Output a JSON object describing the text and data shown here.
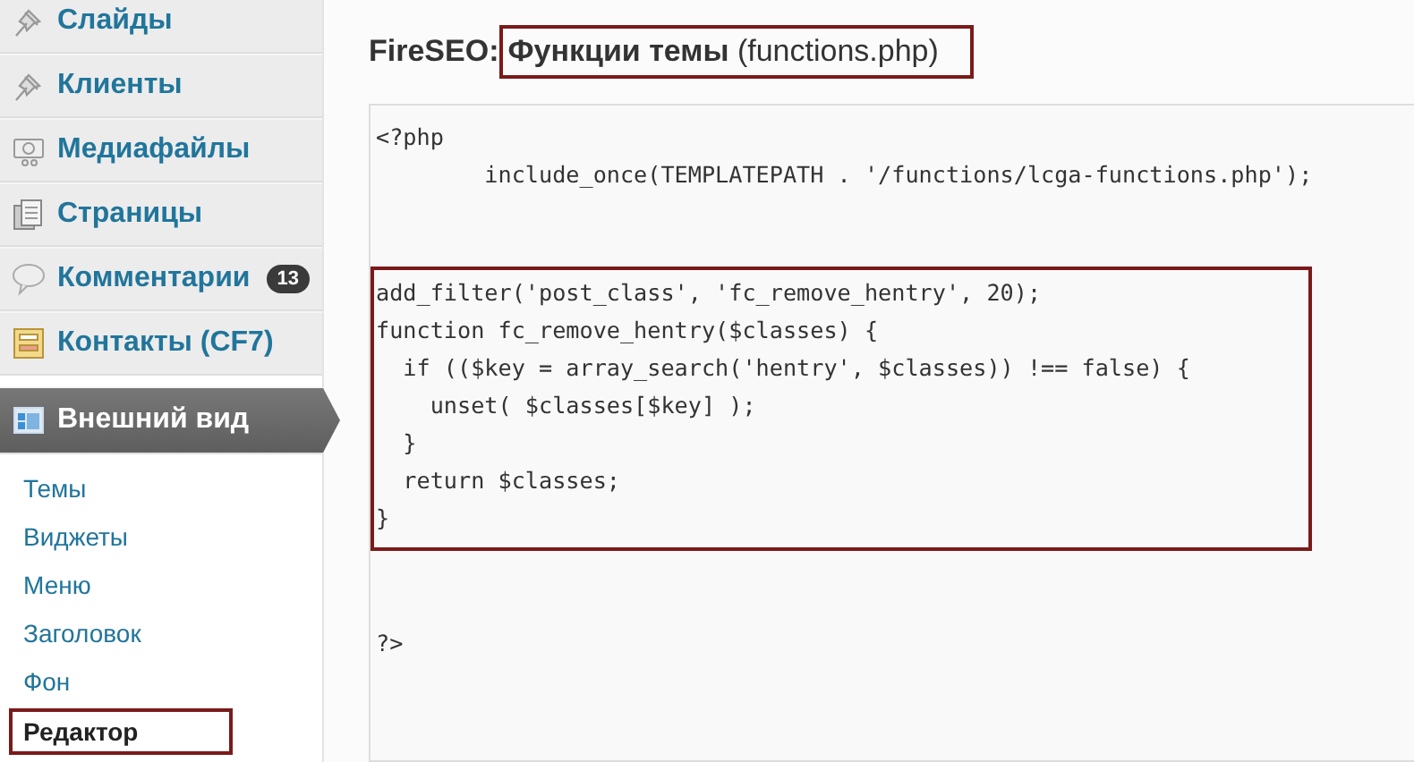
{
  "sidebar": {
    "menu": [
      {
        "label": "Слайды",
        "kind": "pin",
        "current": false
      },
      {
        "label": "Клиенты",
        "kind": "pin",
        "current": false
      },
      {
        "label": "Медиафайлы",
        "kind": "media",
        "current": false
      },
      {
        "label": "Страницы",
        "kind": "pages",
        "current": false
      },
      {
        "label": "Комментарии",
        "kind": "comments",
        "current": false,
        "badge": "13"
      },
      {
        "label": "Контакты (CF7)",
        "kind": "contacts",
        "current": false
      },
      {
        "label": "Внешний вид",
        "kind": "appearance",
        "current": true
      }
    ],
    "submenu": [
      {
        "label": "Темы",
        "selected": false,
        "highlighted": false
      },
      {
        "label": "Виджеты",
        "selected": false,
        "highlighted": false
      },
      {
        "label": "Меню",
        "selected": false,
        "highlighted": false
      },
      {
        "label": "Заголовок",
        "selected": false,
        "highlighted": false
      },
      {
        "label": "Фон",
        "selected": false,
        "highlighted": false
      },
      {
        "label": "Редактор",
        "selected": true,
        "highlighted": true
      }
    ]
  },
  "page": {
    "title_prefix": "FireSEO:",
    "title": "**Функции темы** (functions.php)",
    "title_highlighted": true
  },
  "code": {
    "blocks": [
      {
        "highlighted": false,
        "lines": [
          "<?php",
          "        include_once(TEMPLATEPATH . '/functions/lcga-functions.php');"
        ]
      },
      {
        "highlighted": true,
        "lines": [
          "add_filter('post_class', 'fc_remove_hentry', 20);",
          "function fc_remove_hentry($classes) {",
          "  if (($key = array_search('hentry', $classes)) !== false) {",
          "    unset( $classes[$key] );",
          "  }",
          "  return $classes;",
          "}"
        ]
      },
      {
        "highlighted": false,
        "lines": [
          "?>"
        ]
      }
    ]
  }
}
